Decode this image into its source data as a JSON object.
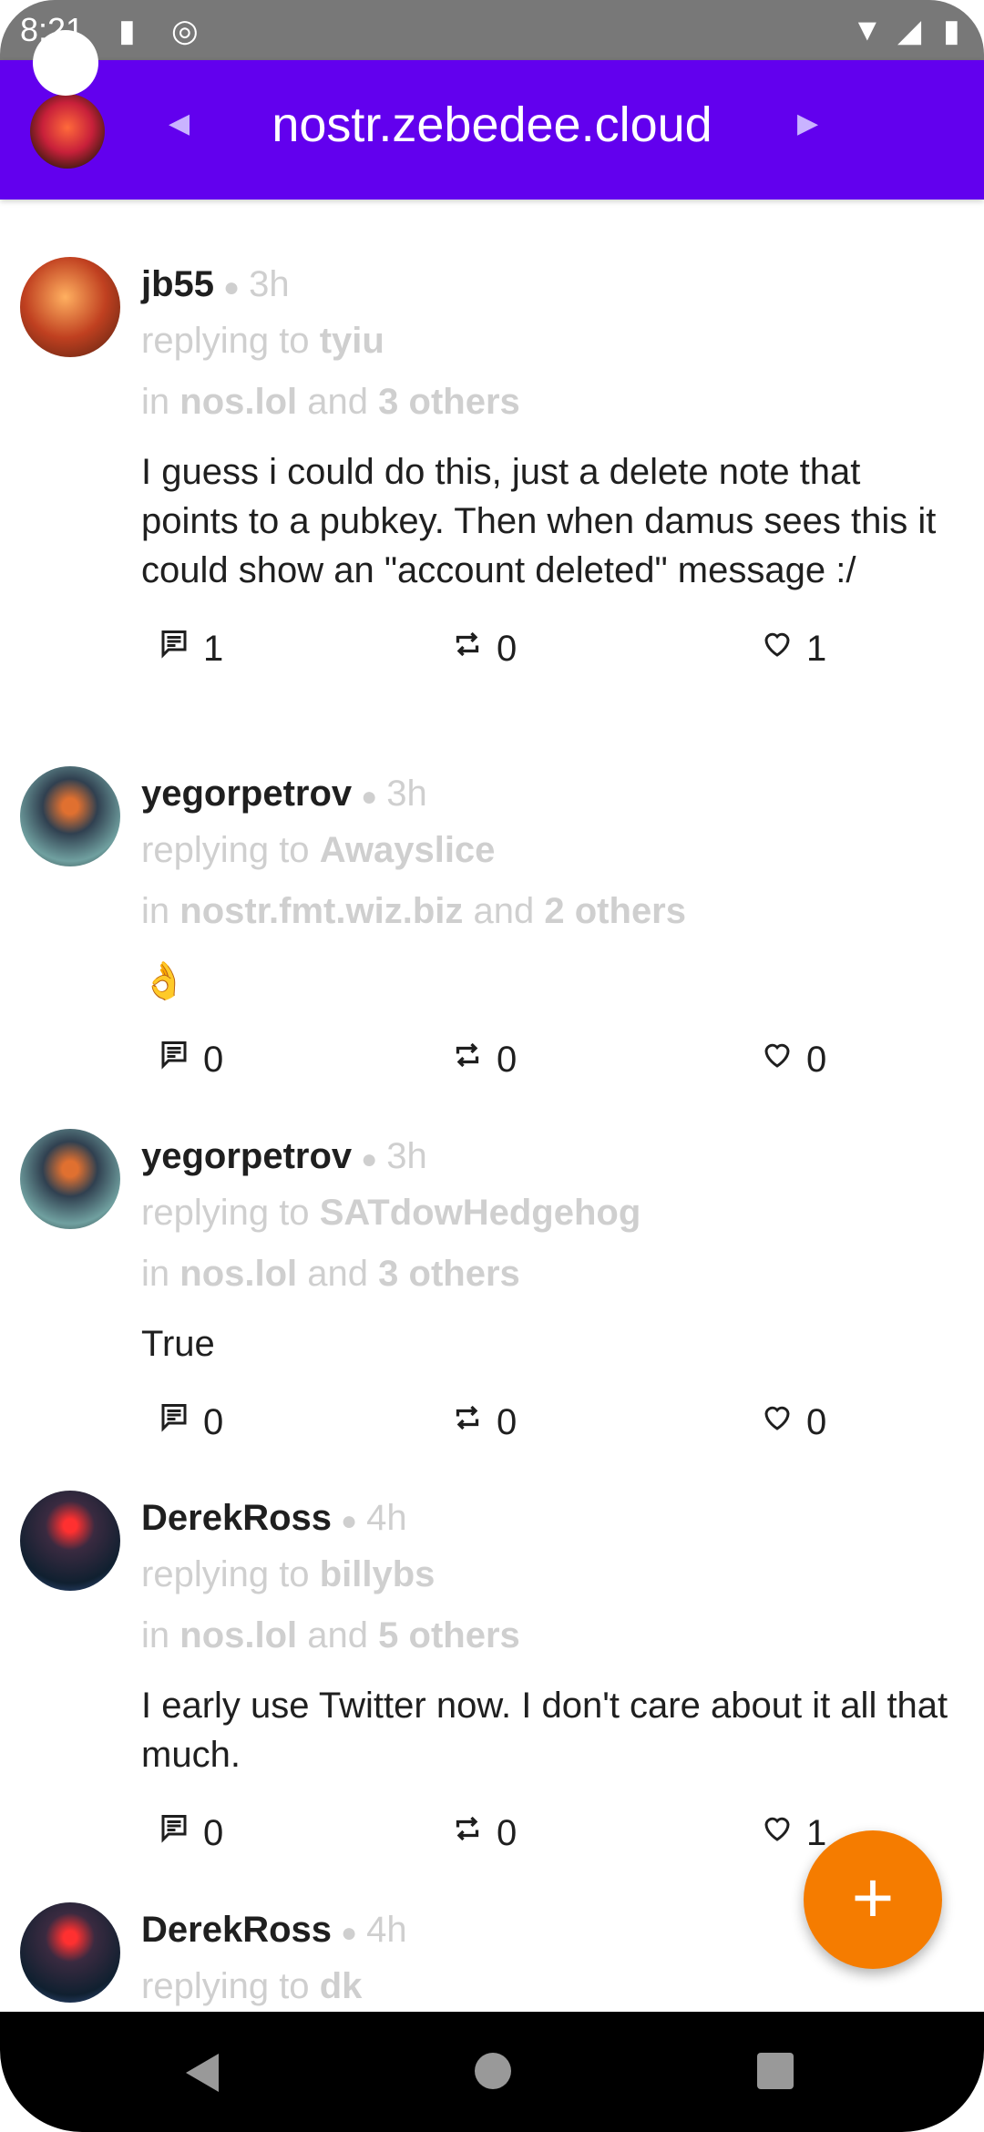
{
  "status_bar": {
    "time": "8:21"
  },
  "header": {
    "title": "nostr.zebedee.cloud"
  },
  "posts": [
    {
      "author": "jb55",
      "time": "3h",
      "replying_prefix": "replying to",
      "replying_to": "tyiu",
      "in_prefix": "in",
      "relay": "nos.lol",
      "and": "and",
      "others": "3 others",
      "body": "I guess i could do this, just a delete note that points to a pubkey. Then when damus sees this it could show an \"account deleted\" message :/",
      "replies": "1",
      "reposts": "0",
      "likes": "1",
      "avatar": "av-jb"
    },
    {
      "author": "yegorpetrov",
      "time": "3h",
      "replying_prefix": "replying to",
      "replying_to": "Awayslice",
      "in_prefix": "in",
      "relay": "nostr.fmt.wiz.biz",
      "and": "and",
      "others": "2 others",
      "body": "👌",
      "replies": "0",
      "reposts": "0",
      "likes": "0",
      "avatar": "av-yp"
    },
    {
      "author": "yegorpetrov",
      "time": "3h",
      "replying_prefix": "replying to",
      "replying_to": "SATdowHedgehog",
      "in_prefix": "in",
      "relay": "nos.lol",
      "and": "and",
      "others": "3 others",
      "body": "True",
      "replies": "0",
      "reposts": "0",
      "likes": "0",
      "avatar": "av-yp"
    },
    {
      "author": "DerekRoss",
      "time": "4h",
      "replying_prefix": "replying to",
      "replying_to": "billybs",
      "in_prefix": "in",
      "relay": "nos.lol",
      "and": "and",
      "others": "5 others",
      "body": "I early use Twitter now. I don't care about it all that much.",
      "replies": "0",
      "reposts": "0",
      "likes": "1",
      "avatar": "av-dr"
    },
    {
      "author": "DerekRoss",
      "time": "4h",
      "replying_prefix": "replying to",
      "replying_to": "dk",
      "avatar": "av-dr"
    }
  ],
  "fab": {
    "label": "+"
  }
}
